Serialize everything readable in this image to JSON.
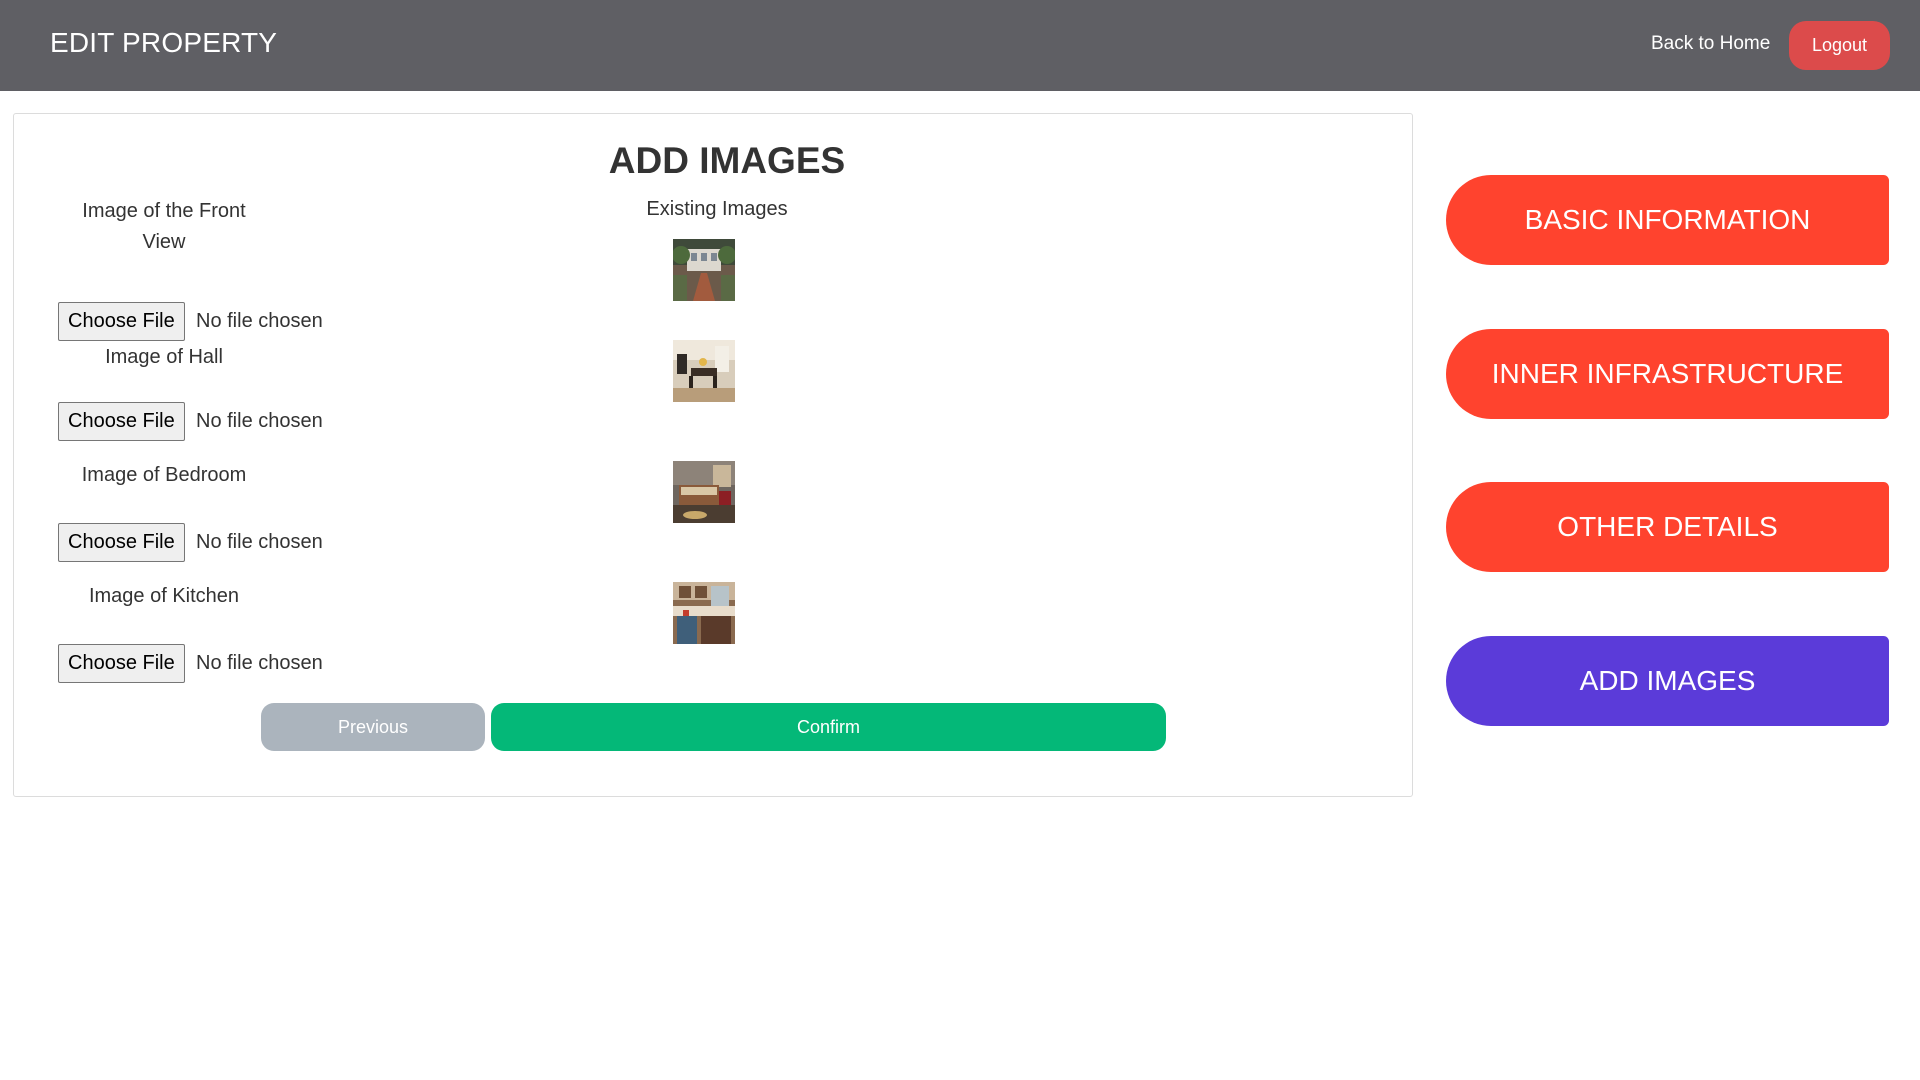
{
  "header": {
    "title": "EDIT PROPERTY",
    "back_label": "Back to Home",
    "logout_label": "Logout"
  },
  "form": {
    "heading": "ADD IMAGES",
    "existing_label": "Existing Images",
    "fields": [
      {
        "label": "Image of the Front View",
        "button_label": "Choose File",
        "status": "No file chosen",
        "thumb_icon": "front-view-photo"
      },
      {
        "label": "Image of Hall",
        "button_label": "Choose File",
        "status": "No file chosen",
        "thumb_icon": "hall-photo"
      },
      {
        "label": "Image of Bedroom",
        "button_label": "Choose File",
        "status": "No file chosen",
        "thumb_icon": "bedroom-photo"
      },
      {
        "label": "Image of Kitchen",
        "button_label": "Choose File",
        "status": "No file chosen",
        "thumb_icon": "kitchen-photo"
      }
    ],
    "previous_label": "Previous",
    "confirm_label": "Confirm"
  },
  "sidebar": {
    "items": [
      {
        "label": "BASIC INFORMATION",
        "active": false
      },
      {
        "label": "INNER INFRASTRUCTURE",
        "active": false
      },
      {
        "label": "OTHER DETAILS",
        "active": false
      },
      {
        "label": "ADD IMAGES",
        "active": true
      }
    ]
  },
  "colors": {
    "header_bg": "#5f5f64",
    "logout": "#dc4b4b",
    "side_inactive": "#ff432e",
    "side_active": "#5b3bd9",
    "previous": "#abb4bd",
    "confirm": "#04b878"
  }
}
